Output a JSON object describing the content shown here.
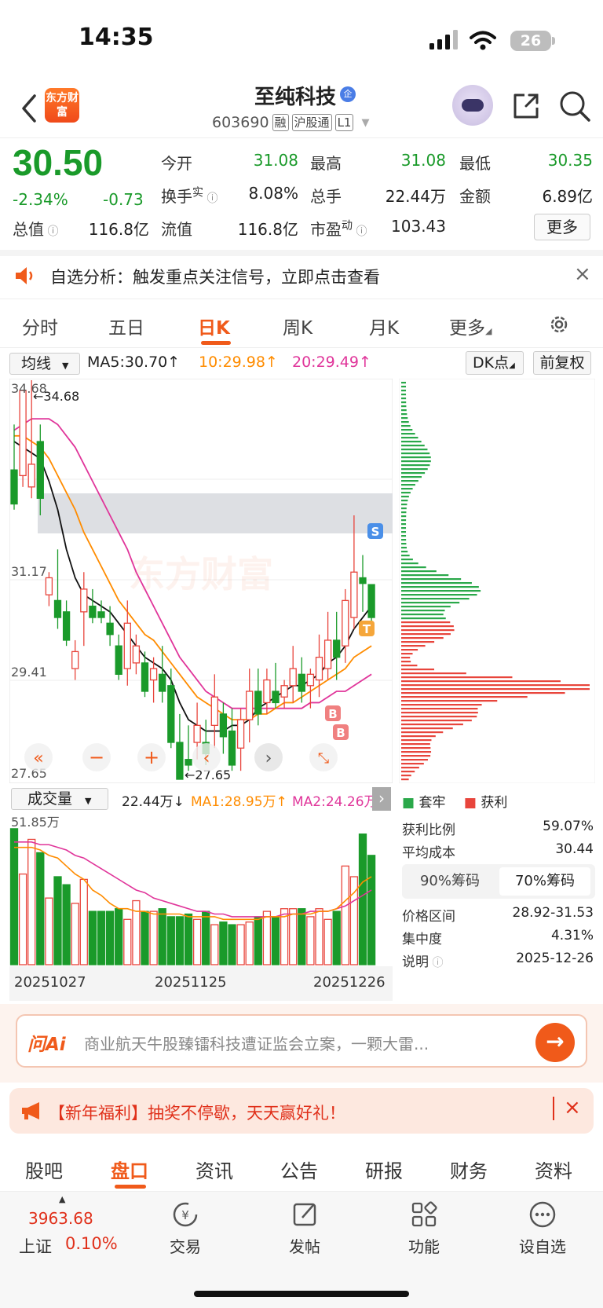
{
  "status_bar": {
    "time": "14:35",
    "battery": "26"
  },
  "header": {
    "logo_text": "东方财富",
    "stock_name": "至纯科技",
    "cert_badge": "企",
    "stock_code": "603690",
    "tags": [
      "融",
      "沪股通",
      "L1"
    ],
    "icons": [
      "back-icon",
      "robot-assistant-icon",
      "share-icon",
      "search-icon"
    ]
  },
  "quote": {
    "price": "30.50",
    "change_pct": "-2.34%",
    "change": "-0.73",
    "fields": [
      {
        "label": "今开",
        "value": "31.08",
        "color": "green"
      },
      {
        "label": "最高",
        "value": "31.08",
        "color": "green"
      },
      {
        "label": "最低",
        "value": "30.35",
        "color": "green"
      },
      {
        "label": "换手",
        "sup": "实",
        "value": "8.08%"
      },
      {
        "label": "总手",
        "value": "22.44万"
      },
      {
        "label": "金额",
        "value": "6.89亿"
      },
      {
        "label": "总值",
        "value": "116.8亿"
      },
      {
        "label": "流值",
        "value": "116.8亿"
      },
      {
        "label": "市盈",
        "sup": "动",
        "value": "103.43"
      }
    ],
    "more_button": "更多"
  },
  "notice": {
    "text": "自选分析：触发重点关注信号，立即点击查看",
    "close": "×"
  },
  "chart_tabs": [
    "分时",
    "五日",
    "日K",
    "周K",
    "月K",
    "更多"
  ],
  "active_chart_tab": "日K",
  "ma_row": {
    "selector": "均线",
    "ma5": "MA5:30.70↑",
    "ma10": "10:29.98↑",
    "ma20": "20:29.49↑",
    "dk_button": "DK点",
    "adjust_button": "前复权"
  },
  "volume_row": {
    "selector": "成交量",
    "vol": "22.44万↓",
    "ma1": "MA1:28.95万↑",
    "ma2": "MA2:24.26万"
  },
  "chip_panel": {
    "legend": [
      {
        "label": "套牢",
        "color": "#2aa84a"
      },
      {
        "label": "获利",
        "color": "#e8453c"
      }
    ],
    "profit_ratio_label": "获利比例",
    "profit_ratio": "59.07%",
    "avg_cost_label": "平均成本",
    "avg_cost": "30.44",
    "tabs": [
      "90%筹码",
      "70%筹码"
    ],
    "active_tab": "70%筹码",
    "price_range_label": "价格区间",
    "price_range": "28.92-31.53",
    "concentration_label": "集中度",
    "concentration": "4.31%",
    "note_label": "说明",
    "note_date": "2025-12-26"
  },
  "ai_bar": {
    "brand": "问Ai",
    "text": "商业航天牛股臻镭科技遭证监会立案，一颗大雷..."
  },
  "promo_bar": {
    "text": "【新年福利】抽奖不停歇，天天赢好礼！",
    "close": "×"
  },
  "bottom_tabs": [
    "股吧",
    "盘口",
    "资讯",
    "公告",
    "研报",
    "财务",
    "资料"
  ],
  "active_bottom_tab": "盘口",
  "nav": {
    "index_value": "3963.68",
    "index_name": "上证",
    "index_change": "0.10%",
    "items": [
      "交易",
      "发帖",
      "功能",
      "设自选"
    ]
  },
  "chart_data": {
    "type": "candlestick",
    "watermark": "东方财富",
    "ytick_labels": [
      "34.68",
      "31.17",
      "29.41",
      "27.65"
    ],
    "max_label": "34.68",
    "min_label": "27.65",
    "x_labels": [
      "20251027",
      "20251125",
      "20251226"
    ],
    "volume_max_label": "51.85万",
    "colors": {
      "up": "#e8453c",
      "down": "#1a9a2a",
      "ma5": "#111111",
      "ma10": "#ff8c00",
      "ma20": "#e0359a"
    },
    "candles": [
      [
        33.1,
        33.9,
        32.5,
        32.4,
        "down"
      ],
      [
        33.0,
        33.7,
        34.5,
        32.8,
        "up"
      ],
      [
        32.8,
        34.68,
        33.2,
        32.6,
        "up"
      ],
      [
        33.6,
        33.9,
        32.6,
        32.3,
        "down"
      ],
      [
        31.2,
        31.3,
        30.9,
        30.7,
        "up"
      ],
      [
        30.8,
        31.7,
        30.5,
        30.3,
        "down"
      ],
      [
        30.6,
        30.8,
        30.1,
        30.0,
        "down"
      ],
      [
        29.6,
        30.1,
        29.9,
        29.4,
        "up"
      ],
      [
        30.6,
        31.3,
        31.0,
        30.0,
        "up"
      ],
      [
        30.7,
        31.0,
        30.5,
        30.4,
        "down"
      ],
      [
        30.6,
        30.8,
        30.5,
        30.4,
        "down"
      ],
      [
        30.4,
        30.7,
        30.2,
        30.0,
        "down"
      ],
      [
        30.0,
        30.2,
        29.5,
        29.4,
        "down"
      ],
      [
        29.6,
        30.8,
        30.4,
        29.3,
        "up"
      ],
      [
        30.0,
        30.2,
        29.7,
        29.5,
        "up"
      ],
      [
        29.7,
        29.9,
        29.2,
        29.1,
        "down"
      ],
      [
        29.4,
        29.8,
        29.6,
        29.0,
        "up"
      ],
      [
        29.5,
        30.0,
        29.2,
        29.0,
        "down"
      ],
      [
        29.3,
        29.6,
        28.3,
        28.2,
        "down"
      ],
      [
        28.3,
        28.8,
        27.65,
        27.7,
        "down"
      ],
      [
        27.9,
        28.6,
        28.0,
        27.8,
        "down"
      ],
      [
        28.3,
        29.0,
        28.6,
        28.0,
        "up"
      ],
      [
        28.3,
        28.7,
        28.1,
        27.9,
        "down"
      ],
      [
        28.6,
        29.5,
        29.1,
        28.2,
        "up"
      ],
      [
        28.8,
        29.0,
        28.4,
        28.1,
        "down"
      ],
      [
        28.5,
        28.9,
        27.9,
        27.8,
        "down"
      ],
      [
        28.2,
        28.9,
        28.7,
        27.8,
        "up"
      ],
      [
        28.7,
        29.6,
        29.2,
        28.3,
        "up"
      ],
      [
        29.2,
        29.6,
        28.8,
        28.6,
        "down"
      ],
      [
        29.0,
        29.6,
        29.4,
        28.8,
        "up"
      ],
      [
        29.2,
        29.7,
        29.0,
        28.9,
        "down"
      ],
      [
        29.1,
        29.4,
        29.3,
        28.9,
        "up"
      ],
      [
        29.3,
        30.0,
        29.6,
        29.0,
        "up"
      ],
      [
        29.5,
        29.8,
        29.2,
        29.0,
        "down"
      ],
      [
        29.3,
        29.6,
        29.5,
        28.9,
        "up"
      ],
      [
        29.4,
        30.2,
        29.8,
        29.1,
        "up"
      ],
      [
        29.6,
        30.6,
        30.1,
        29.4,
        "up"
      ],
      [
        30.1,
        30.6,
        29.8,
        29.4,
        "down"
      ],
      [
        30.0,
        31.0,
        30.8,
        29.7,
        "up"
      ],
      [
        30.5,
        32.3,
        31.3,
        30.3,
        "up"
      ],
      [
        31.2,
        31.6,
        31.1,
        30.6,
        "down"
      ],
      [
        31.08,
        31.08,
        30.5,
        30.35,
        "down"
      ]
    ],
    "ma5": [
      33.6,
      33.5,
      33.4,
      33.3,
      32.9,
      32.4,
      31.7,
      31.2,
      30.9,
      30.8,
      30.7,
      30.6,
      30.4,
      30.2,
      30.0,
      29.8,
      29.7,
      29.6,
      29.4,
      29.0,
      28.7,
      28.6,
      28.5,
      28.5,
      28.5,
      28.6,
      28.6,
      28.7,
      28.9,
      29.0,
      29.1,
      29.2,
      29.3,
      29.3,
      29.4,
      29.5,
      29.7,
      29.8,
      30.0,
      30.3,
      30.5,
      30.7
    ],
    "ma10": [
      33.7,
      33.7,
      33.6,
      33.5,
      33.3,
      33.0,
      32.7,
      32.4,
      32.0,
      31.7,
      31.4,
      31.1,
      30.8,
      30.6,
      30.4,
      30.2,
      30.1,
      29.9,
      29.7,
      29.5,
      29.3,
      29.1,
      29.0,
      28.9,
      28.8,
      28.7,
      28.7,
      28.7,
      28.8,
      28.8,
      28.9,
      29.0,
      29.0,
      29.1,
      29.2,
      29.3,
      29.4,
      29.5,
      29.6,
      29.8,
      29.9,
      30.0
    ],
    "ma20": [
      33.8,
      33.9,
      34.0,
      34.0,
      34.0,
      33.9,
      33.7,
      33.5,
      33.2,
      32.9,
      32.6,
      32.3,
      32.0,
      31.7,
      31.3,
      31.0,
      30.7,
      30.4,
      30.1,
      29.8,
      29.6,
      29.4,
      29.2,
      29.1,
      29.0,
      28.9,
      28.9,
      28.9,
      28.9,
      28.9,
      28.9,
      28.9,
      28.9,
      28.9,
      29.0,
      29.0,
      29.1,
      29.2,
      29.2,
      29.3,
      29.4,
      29.5
    ],
    "volumes": [
      51,
      34,
      47,
      42,
      25,
      33,
      30,
      23,
      32,
      20,
      20,
      20,
      21,
      17,
      24,
      20,
      20,
      21,
      18,
      18,
      19,
      17,
      20,
      15,
      16,
      15,
      15,
      16,
      18,
      20,
      18,
      21,
      21,
      21,
      18,
      21,
      17,
      20,
      37,
      33,
      49,
      41
    ],
    "vol_ma1": [
      44,
      44,
      44,
      43,
      41,
      40,
      37,
      34,
      32,
      28,
      26,
      23,
      21,
      21,
      20,
      20,
      19,
      19,
      19,
      19,
      18,
      18,
      18,
      18,
      17,
      17,
      17,
      17,
      17,
      18,
      18,
      18,
      19,
      19,
      19,
      20,
      20,
      21,
      24,
      27,
      31,
      33
    ],
    "vol_ma2": [
      46,
      46,
      46,
      45,
      45,
      44,
      43,
      41,
      40,
      38,
      36,
      34,
      32,
      30,
      28,
      27,
      25,
      24,
      23,
      22,
      21,
      20,
      20,
      19,
      19,
      18,
      18,
      18,
      18,
      18,
      18,
      19,
      19,
      19,
      20,
      20,
      20,
      21,
      22,
      24,
      26,
      28
    ]
  }
}
